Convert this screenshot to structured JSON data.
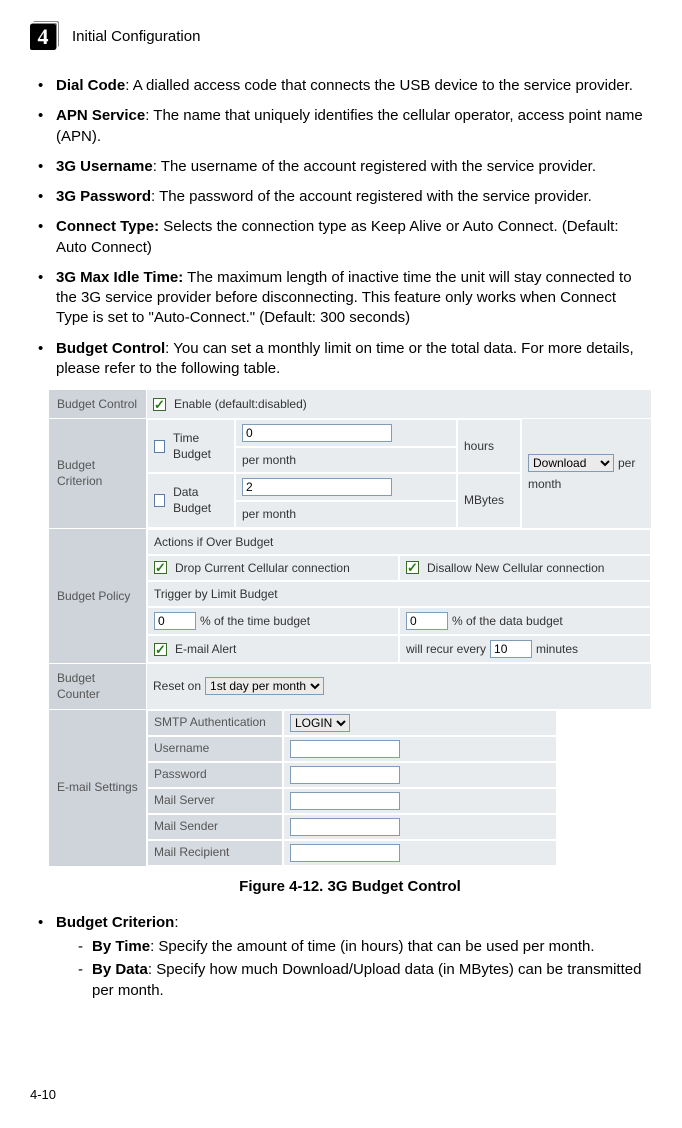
{
  "chapter": {
    "number": "4",
    "title": "Initial Configuration"
  },
  "bullets": {
    "dial": {
      "term": "Dial Code",
      "rest": ": A dialled access code that connects the USB device to the service provider."
    },
    "apn": {
      "term": "APN Service",
      "rest": ": The name that uniquely identifies the cellular operator, access point name (APN)."
    },
    "user": {
      "term": "3G Username",
      "rest": ": The username of the account registered with the service provider."
    },
    "pass": {
      "term": "3G Password",
      "rest": ": The password of the account registered with the service provider."
    },
    "conn": {
      "term": "Connect Type:",
      "rest": " Selects the connection type as Keep Alive or Auto Connect. (Default: Auto Connect)"
    },
    "idle": {
      "term": "3G Max Idle Time:",
      "rest": " The maximum length of inactive time the unit will stay connected to the 3G service provider before disconnecting. This feature only works when Connect Type is set to \"Auto-Connect.\" (Default: 300 seconds)"
    },
    "budget": {
      "term": "Budget Control",
      "rest": ": You can set a monthly limit on time or the total data. For more details, please refer to the following table."
    }
  },
  "fig": {
    "labels": {
      "budget_control": "Budget Control",
      "budget_criterion": "Budget Criterion",
      "budget_policy": "Budget Policy",
      "budget_counter": "Budget Counter",
      "email_settings": "E-mail Settings",
      "enable": "Enable (default:disabled)",
      "time_budget": "Time Budget",
      "data_budget": "Data Budget",
      "hours": "hours",
      "per_month": "per month",
      "mbytes": "MBytes",
      "download": "Download",
      "per": "per",
      "month": "month",
      "actions_over": "Actions if Over Budget",
      "drop": "Drop Current Cellular connection",
      "disallow": "Disallow New Cellular connection",
      "trigger": "Trigger by Limit Budget",
      "pct_time": "% of the time budget",
      "pct_data": "% of the data budget",
      "email_alert": "E-mail Alert",
      "recur": "will recur every ",
      "minutes": "minutes",
      "reset_on": "Reset on ",
      "first_day": "1st day per month",
      "smtp": "SMTP Authentication",
      "login": "LOGIN",
      "username": "Username",
      "password": "Password",
      "mail_server": "Mail Server",
      "mail_sender": "Mail Sender",
      "mail_recipient": "Mail Recipient"
    },
    "values": {
      "time_hours": "0",
      "data_mb": "2",
      "pct_time": "0",
      "pct_data": "0",
      "recur_min": "10"
    },
    "caption": "Figure 4-12.   3G Budget Control"
  },
  "criterion_head": {
    "term": "Budget Criterion",
    "rest": ":"
  },
  "criterion_sub": {
    "bytime": {
      "term": "By Time",
      "rest": ":  Specify the amount of time (in hours) that can be used per month."
    },
    "bydata": {
      "term": "By Data",
      "rest": ": Specify how much Download/Upload data (in MBytes) can be transmitted per month."
    }
  },
  "page_number": "4-10"
}
